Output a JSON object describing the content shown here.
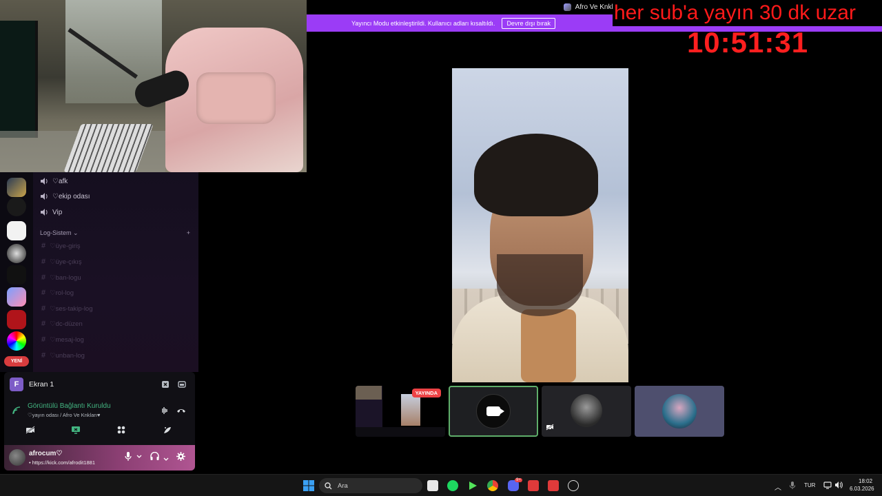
{
  "window": {
    "server_title": "Afro Ve Knkları♥",
    "streamer_mode_text": "Yayıncı Modu etkinleştirildi. Kullanıcı adları kısaltıldı.",
    "disable_button_label": "Devre dışı bırak"
  },
  "overlay": {
    "sub_text": "her sub'a yayın 30 dk uzar",
    "timer": "10:51:31"
  },
  "sidebar": {
    "new_badge": "YENİ",
    "voice_channels": [
      {
        "label": "♡afk"
      },
      {
        "label": "♡ekip odası"
      },
      {
        "label": "Vip"
      }
    ],
    "category": {
      "label": "Log-Sistem ⌄",
      "add": "+"
    },
    "text_channels": [
      {
        "label": "♡üye-giriş"
      },
      {
        "label": "♡üye-çıkış"
      },
      {
        "label": "♡ban-logu"
      },
      {
        "label": "♡rol-log"
      },
      {
        "label": "♡ses-takip-log"
      },
      {
        "label": "♡dc-düzen"
      },
      {
        "label": "♡mesaj-log"
      },
      {
        "label": "♡unban-log"
      }
    ]
  },
  "voice_panel": {
    "screen_avatar_letter": "F",
    "screen_label": "Ekran 1",
    "connection_title": "Görüntülü Bağlantı Kuruldu",
    "connection_sub": "♡yayın odası / Afro Ve Knkları♥",
    "username": "afrocum♡",
    "status": "• https://kick.com/afrodit1881"
  },
  "thumbnails": {
    "live_label": "YAYINDA"
  },
  "taskbar": {
    "search_placeholder": "Ara",
    "discord_badge": "9+",
    "language": "TUR",
    "time": "18:02",
    "date": "6.03.2026"
  },
  "colors": {
    "banner": "#9b3cf6",
    "overlay_red": "#ff1a1a",
    "connected_green": "#43b581",
    "live_red": "#ed4245"
  }
}
